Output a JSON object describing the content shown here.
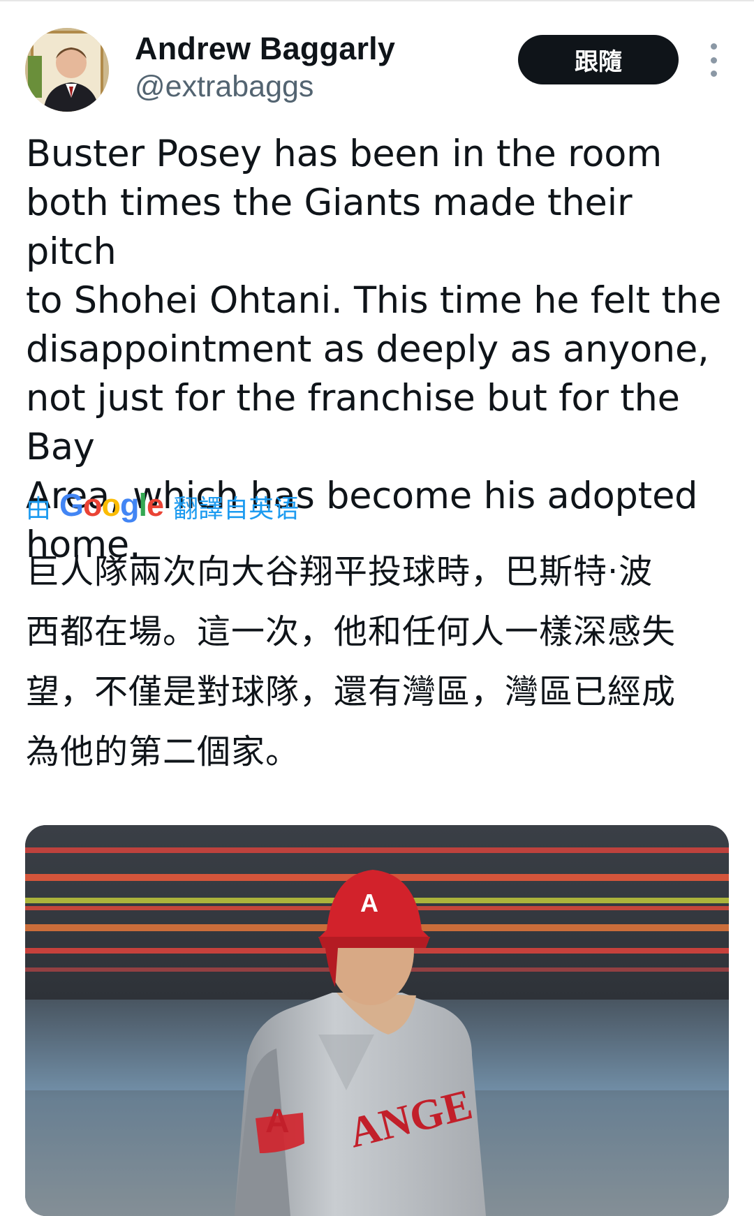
{
  "author": {
    "name": "Andrew Baggarly",
    "handle": "@extrabaggs"
  },
  "follow_button": {
    "label": "跟隨"
  },
  "tweet": {
    "text": "Buster Posey has been in the room\nboth times the Giants made their pitch\nto Shohei Ohtani. This time he felt the\ndisappointment as deeply as anyone,\nnot just for the franchise but for the Bay\nArea, which has become his adopted\nhome."
  },
  "translation": {
    "prefix": "由",
    "provider_letters": [
      "G",
      "o",
      "o",
      "g",
      "l",
      "e"
    ],
    "suffix": "翻譯自英语",
    "text": "巨人隊兩次向大谷翔平投球時，巴斯特·波\n西都在場。這一次，他和任何人一樣深感失\n望，不僅是對球隊，還有灣區，灣區已經成\n為他的第二個家。"
  },
  "media": {
    "jersey_text": "ANGE",
    "helmet_letter": "A",
    "sleeve_letter": "A"
  },
  "colors": {
    "accent": "#1d9bf0",
    "text": "#0f1419",
    "secondary": "#536471",
    "button_bg": "#0f1419"
  },
  "icons": [
    "more-vertical-icon",
    "google-logo"
  ]
}
